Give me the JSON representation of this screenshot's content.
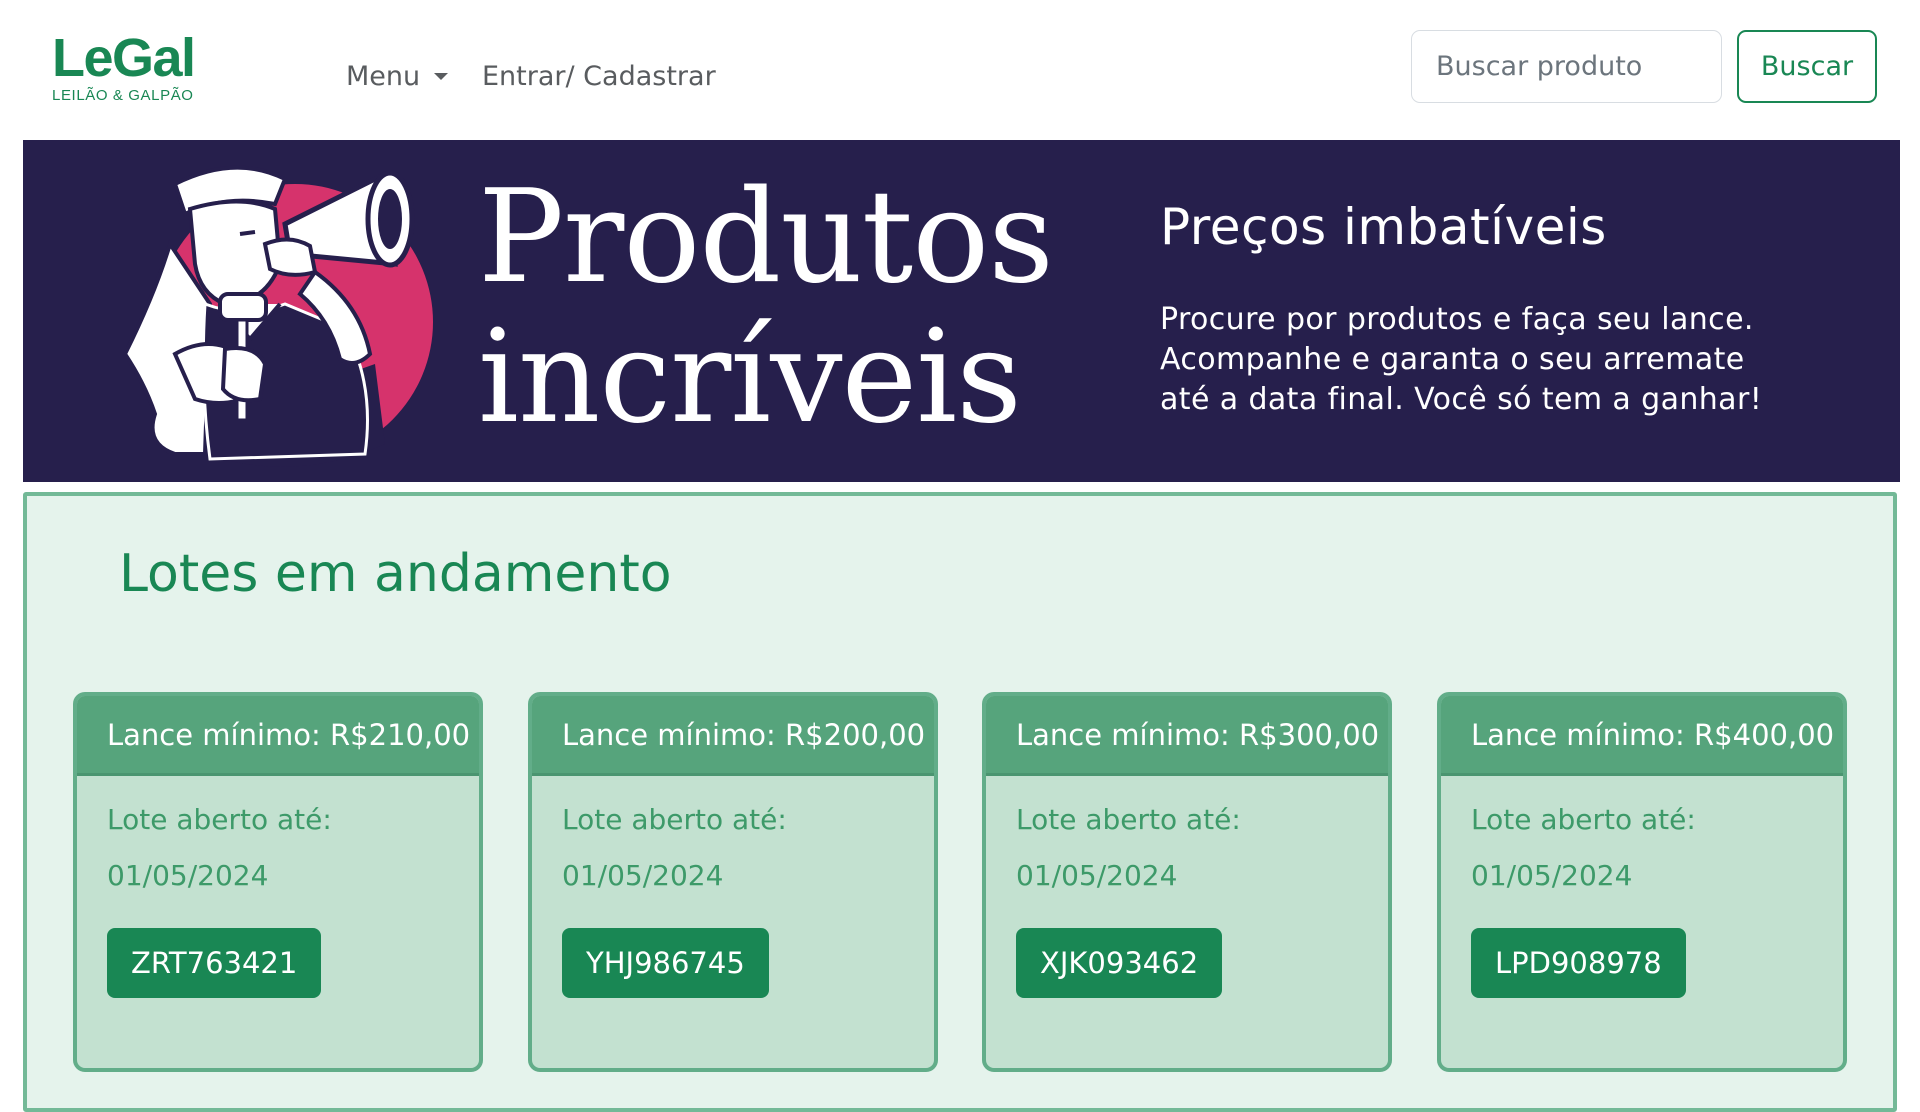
{
  "navbar": {
    "logo_main": "LeGal",
    "logo_sub": "LEILÃO & GALPÃO",
    "menu_label": "Menu",
    "login_label": "Entrar/ Cadastrar",
    "search_placeholder": "Buscar produto",
    "search_button": "Buscar"
  },
  "banner": {
    "title_line1": "Produtos",
    "title_line2": "incríveis",
    "heading": "Preços imbatíveis",
    "text_line1": "Procure por produtos e faça seu lance.",
    "text_line2": "Acompanhe e garanta o seu arremate",
    "text_line3": "até a data final. Você só tem a ganhar!",
    "mascot_icon": "auctioneer-megaphone-illustration"
  },
  "lots": {
    "title": "Lotes em andamento",
    "cards": [
      {
        "header": "Lance mínimo: R$210,00",
        "label": "Lote aberto até:",
        "date": "01/05/2024",
        "code": "ZRT763421"
      },
      {
        "header": "Lance mínimo: R$200,00",
        "label": "Lote aberto até:",
        "date": "01/05/2024",
        "code": "YHJ986745"
      },
      {
        "header": "Lance mínimo: R$300,00",
        "label": "Lote aberto até:",
        "date": "01/05/2024",
        "code": "XJK093462"
      },
      {
        "header": "Lance mínimo: R$400,00",
        "label": "Lote aberto até:",
        "date": "01/05/2024",
        "code": "LPD908978"
      }
    ]
  },
  "colors": {
    "brand_green": "#198754",
    "banner_bg": "#261f4c",
    "accent_pink": "#d6336c",
    "section_bg": "#e5f3ec",
    "card_header": "#56a47c"
  }
}
